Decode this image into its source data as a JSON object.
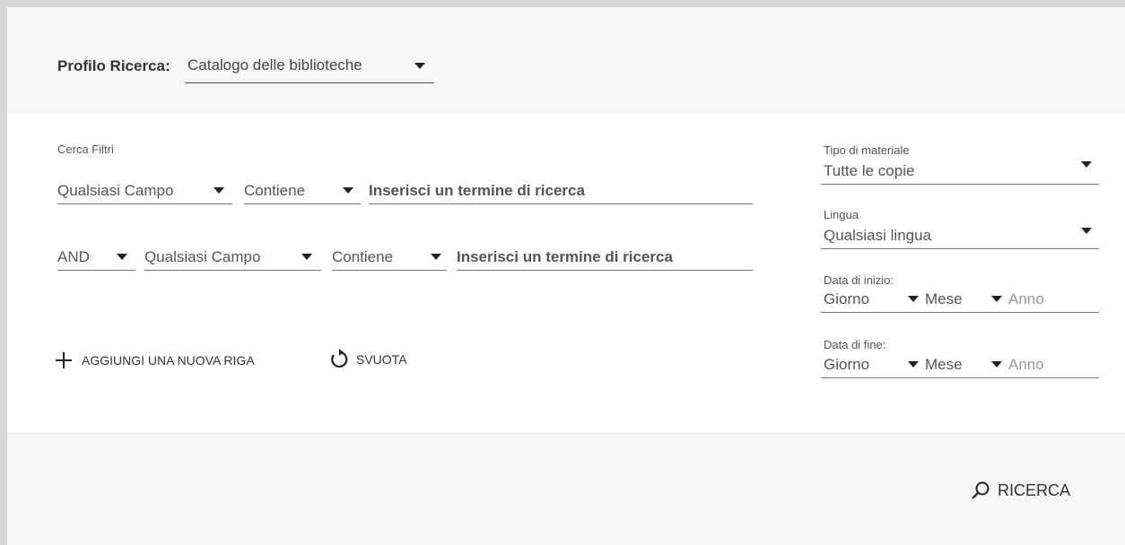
{
  "profile": {
    "label": "Profilo Ricerca:",
    "selected": "Catalogo delle biblioteche"
  },
  "filters": {
    "title": "Cerca Filtri",
    "row1": {
      "field": "Qualsiasi Campo",
      "operator": "Contiene",
      "term_placeholder": "Inserisci un termine di ricerca"
    },
    "row2": {
      "boolean": "AND",
      "field": "Qualsiasi Campo",
      "operator": "Contiene",
      "term_placeholder": "Inserisci un termine di ricerca"
    },
    "add_row_label": "AGGIUNGI UNA NUOVA RIGA",
    "clear_label": "SVUOTA"
  },
  "side": {
    "material_label": "Tipo di materiale",
    "material_value": "Tutte le copie",
    "language_label": "Lingua",
    "language_value": "Qualsiasi lingua",
    "start_label": "Data di inizio:",
    "end_label": "Data di fine:",
    "day": "Giorno",
    "month": "Mese",
    "year": "Anno"
  },
  "search_label": "RICERCA",
  "icons": {
    "plus": "plus-icon",
    "reset": "reset-icon",
    "search": "search-icon",
    "caret": "caret-down-icon"
  }
}
